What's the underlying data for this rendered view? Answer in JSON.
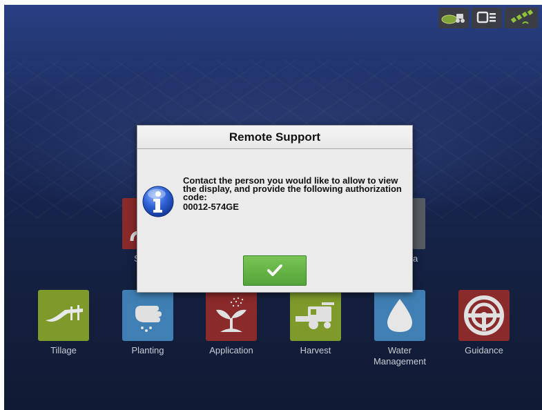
{
  "status_bar": {
    "icons": [
      "field-vehicle-icon",
      "display-network-icon",
      "satellite-gps-icon"
    ]
  },
  "background_tiles": {
    "partial_left_label": "S",
    "partial_right_label": "a"
  },
  "tiles": [
    {
      "label": "Tillage",
      "icon": "plow-icon",
      "color": "#7d9a2b"
    },
    {
      "label": "Planting",
      "icon": "hand-seeds-icon",
      "color": "#3f7fb3"
    },
    {
      "label": "Application",
      "icon": "sprout-spray-icon",
      "color": "#8a2a2a"
    },
    {
      "label": "Harvest",
      "icon": "combine-icon",
      "color": "#7d9a2b"
    },
    {
      "label": "Water\nManagement",
      "icon": "water-drop-icon",
      "color": "#3f7fb3"
    },
    {
      "label": "Guidance",
      "icon": "steering-wheel-icon",
      "color": "#8a2a2a"
    }
  ],
  "dialog": {
    "title": "Remote Support",
    "message": "Contact the person you would like to allow to view the display, and provide the following authorization code:",
    "code": "00012-574GE",
    "ok_icon": "checkmark-icon"
  }
}
